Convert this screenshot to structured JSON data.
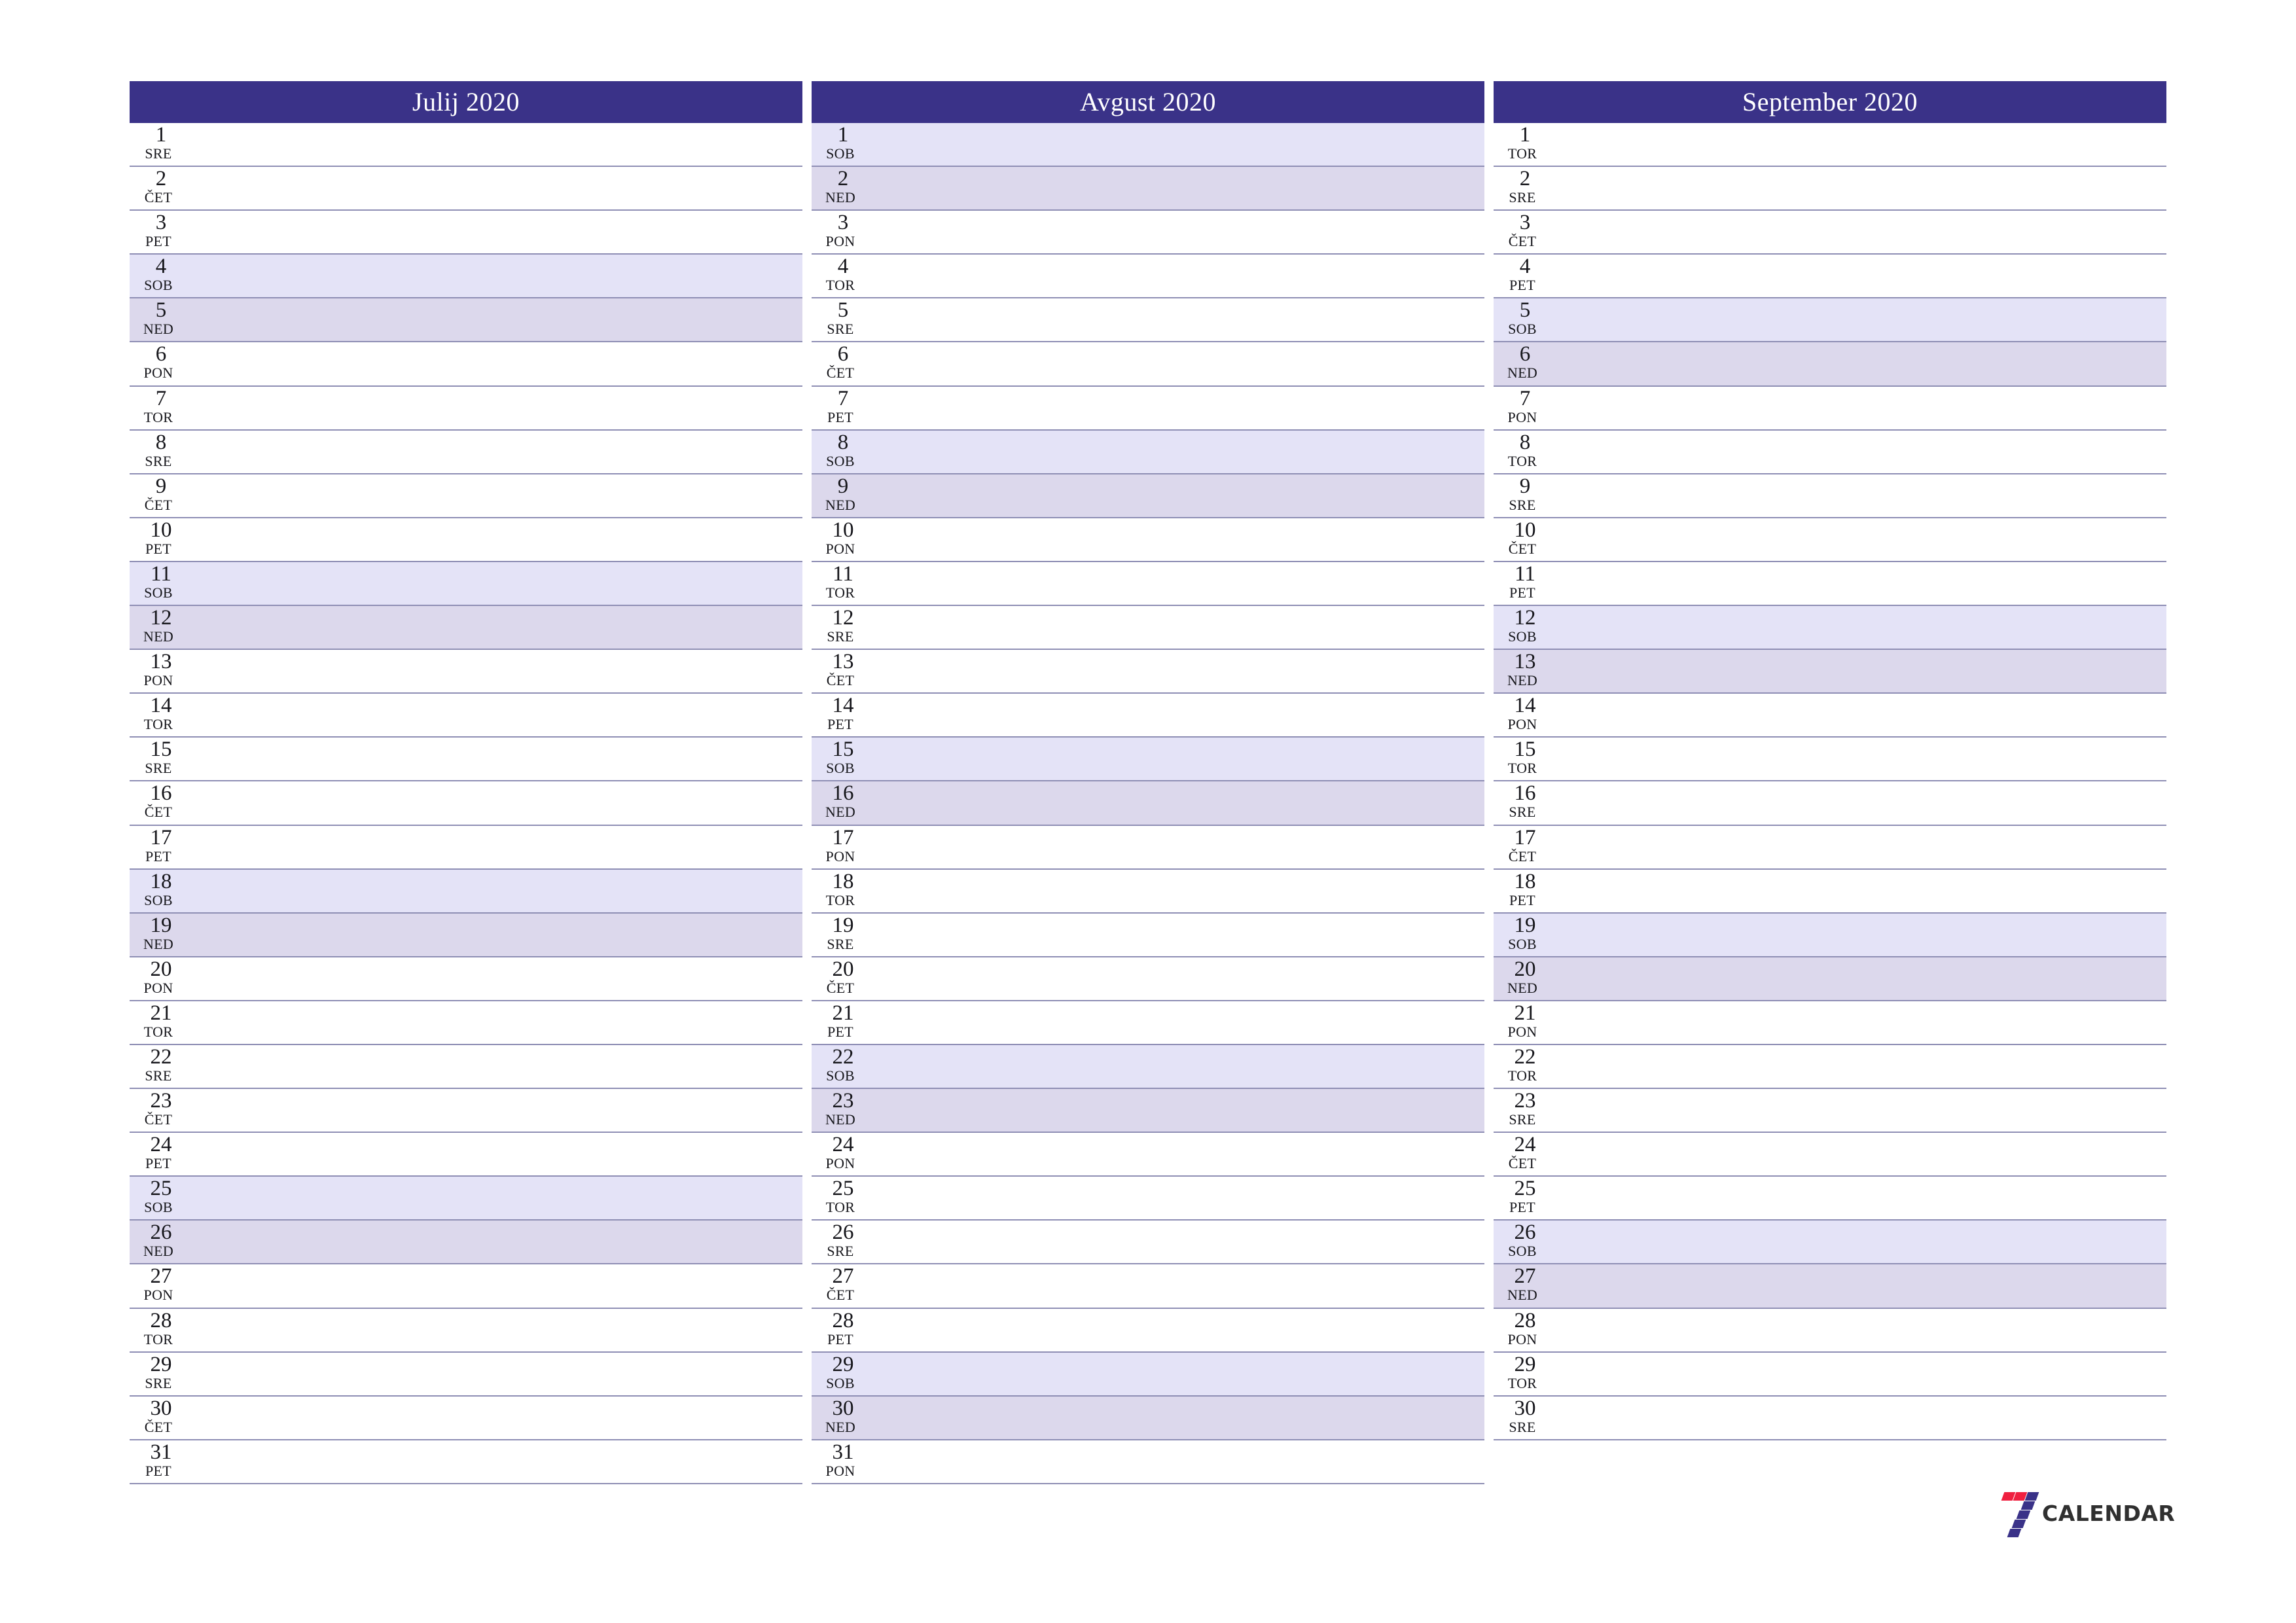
{
  "document": {
    "type": "quarterly-planner-calendar",
    "language": "sl",
    "year": "2020"
  },
  "colors": {
    "header_background": "#3a3288",
    "header_text": "#ffffff",
    "saturday_background": "#e4e3f7",
    "sunday_background": "#dcd8ec",
    "row_separator": "#8e8eb4",
    "day_text": "#17171c",
    "logo_red": "#ef2040",
    "logo_navy": "#3a3288",
    "logo_word": "#303030",
    "page_background": "#ffffff"
  },
  "brand": {
    "logo_name": "seven-calendar-logo",
    "wordmark": "CALENDAR",
    "mark_digit": "7"
  },
  "months": [
    {
      "title": "Julij 2020",
      "name": "Julij",
      "year": "2020",
      "days": [
        {
          "num": "1",
          "wd": "SRE",
          "type": "weekday"
        },
        {
          "num": "2",
          "wd": "ČET",
          "type": "weekday"
        },
        {
          "num": "3",
          "wd": "PET",
          "type": "weekday"
        },
        {
          "num": "4",
          "wd": "SOB",
          "type": "saturday"
        },
        {
          "num": "5",
          "wd": "NED",
          "type": "sunday"
        },
        {
          "num": "6",
          "wd": "PON",
          "type": "weekday"
        },
        {
          "num": "7",
          "wd": "TOR",
          "type": "weekday"
        },
        {
          "num": "8",
          "wd": "SRE",
          "type": "weekday"
        },
        {
          "num": "9",
          "wd": "ČET",
          "type": "weekday"
        },
        {
          "num": "10",
          "wd": "PET",
          "type": "weekday"
        },
        {
          "num": "11",
          "wd": "SOB",
          "type": "saturday"
        },
        {
          "num": "12",
          "wd": "NED",
          "type": "sunday"
        },
        {
          "num": "13",
          "wd": "PON",
          "type": "weekday"
        },
        {
          "num": "14",
          "wd": "TOR",
          "type": "weekday"
        },
        {
          "num": "15",
          "wd": "SRE",
          "type": "weekday"
        },
        {
          "num": "16",
          "wd": "ČET",
          "type": "weekday"
        },
        {
          "num": "17",
          "wd": "PET",
          "type": "weekday"
        },
        {
          "num": "18",
          "wd": "SOB",
          "type": "saturday"
        },
        {
          "num": "19",
          "wd": "NED",
          "type": "sunday"
        },
        {
          "num": "20",
          "wd": "PON",
          "type": "weekday"
        },
        {
          "num": "21",
          "wd": "TOR",
          "type": "weekday"
        },
        {
          "num": "22",
          "wd": "SRE",
          "type": "weekday"
        },
        {
          "num": "23",
          "wd": "ČET",
          "type": "weekday"
        },
        {
          "num": "24",
          "wd": "PET",
          "type": "weekday"
        },
        {
          "num": "25",
          "wd": "SOB",
          "type": "saturday"
        },
        {
          "num": "26",
          "wd": "NED",
          "type": "sunday"
        },
        {
          "num": "27",
          "wd": "PON",
          "type": "weekday"
        },
        {
          "num": "28",
          "wd": "TOR",
          "type": "weekday"
        },
        {
          "num": "29",
          "wd": "SRE",
          "type": "weekday"
        },
        {
          "num": "30",
          "wd": "ČET",
          "type": "weekday"
        },
        {
          "num": "31",
          "wd": "PET",
          "type": "weekday"
        }
      ]
    },
    {
      "title": "Avgust 2020",
      "name": "Avgust",
      "year": "2020",
      "days": [
        {
          "num": "1",
          "wd": "SOB",
          "type": "saturday"
        },
        {
          "num": "2",
          "wd": "NED",
          "type": "sunday"
        },
        {
          "num": "3",
          "wd": "PON",
          "type": "weekday"
        },
        {
          "num": "4",
          "wd": "TOR",
          "type": "weekday"
        },
        {
          "num": "5",
          "wd": "SRE",
          "type": "weekday"
        },
        {
          "num": "6",
          "wd": "ČET",
          "type": "weekday"
        },
        {
          "num": "7",
          "wd": "PET",
          "type": "weekday"
        },
        {
          "num": "8",
          "wd": "SOB",
          "type": "saturday"
        },
        {
          "num": "9",
          "wd": "NED",
          "type": "sunday"
        },
        {
          "num": "10",
          "wd": "PON",
          "type": "weekday"
        },
        {
          "num": "11",
          "wd": "TOR",
          "type": "weekday"
        },
        {
          "num": "12",
          "wd": "SRE",
          "type": "weekday"
        },
        {
          "num": "13",
          "wd": "ČET",
          "type": "weekday"
        },
        {
          "num": "14",
          "wd": "PET",
          "type": "weekday"
        },
        {
          "num": "15",
          "wd": "SOB",
          "type": "saturday"
        },
        {
          "num": "16",
          "wd": "NED",
          "type": "sunday"
        },
        {
          "num": "17",
          "wd": "PON",
          "type": "weekday"
        },
        {
          "num": "18",
          "wd": "TOR",
          "type": "weekday"
        },
        {
          "num": "19",
          "wd": "SRE",
          "type": "weekday"
        },
        {
          "num": "20",
          "wd": "ČET",
          "type": "weekday"
        },
        {
          "num": "21",
          "wd": "PET",
          "type": "weekday"
        },
        {
          "num": "22",
          "wd": "SOB",
          "type": "saturday"
        },
        {
          "num": "23",
          "wd": "NED",
          "type": "sunday"
        },
        {
          "num": "24",
          "wd": "PON",
          "type": "weekday"
        },
        {
          "num": "25",
          "wd": "TOR",
          "type": "weekday"
        },
        {
          "num": "26",
          "wd": "SRE",
          "type": "weekday"
        },
        {
          "num": "27",
          "wd": "ČET",
          "type": "weekday"
        },
        {
          "num": "28",
          "wd": "PET",
          "type": "weekday"
        },
        {
          "num": "29",
          "wd": "SOB",
          "type": "saturday"
        },
        {
          "num": "30",
          "wd": "NED",
          "type": "sunday"
        },
        {
          "num": "31",
          "wd": "PON",
          "type": "weekday"
        }
      ]
    },
    {
      "title": "September 2020",
      "name": "September",
      "year": "2020",
      "days": [
        {
          "num": "1",
          "wd": "TOR",
          "type": "weekday"
        },
        {
          "num": "2",
          "wd": "SRE",
          "type": "weekday"
        },
        {
          "num": "3",
          "wd": "ČET",
          "type": "weekday"
        },
        {
          "num": "4",
          "wd": "PET",
          "type": "weekday"
        },
        {
          "num": "5",
          "wd": "SOB",
          "type": "saturday"
        },
        {
          "num": "6",
          "wd": "NED",
          "type": "sunday"
        },
        {
          "num": "7",
          "wd": "PON",
          "type": "weekday"
        },
        {
          "num": "8",
          "wd": "TOR",
          "type": "weekday"
        },
        {
          "num": "9",
          "wd": "SRE",
          "type": "weekday"
        },
        {
          "num": "10",
          "wd": "ČET",
          "type": "weekday"
        },
        {
          "num": "11",
          "wd": "PET",
          "type": "weekday"
        },
        {
          "num": "12",
          "wd": "SOB",
          "type": "saturday"
        },
        {
          "num": "13",
          "wd": "NED",
          "type": "sunday"
        },
        {
          "num": "14",
          "wd": "PON",
          "type": "weekday"
        },
        {
          "num": "15",
          "wd": "TOR",
          "type": "weekday"
        },
        {
          "num": "16",
          "wd": "SRE",
          "type": "weekday"
        },
        {
          "num": "17",
          "wd": "ČET",
          "type": "weekday"
        },
        {
          "num": "18",
          "wd": "PET",
          "type": "weekday"
        },
        {
          "num": "19",
          "wd": "SOB",
          "type": "saturday"
        },
        {
          "num": "20",
          "wd": "NED",
          "type": "sunday"
        },
        {
          "num": "21",
          "wd": "PON",
          "type": "weekday"
        },
        {
          "num": "22",
          "wd": "TOR",
          "type": "weekday"
        },
        {
          "num": "23",
          "wd": "SRE",
          "type": "weekday"
        },
        {
          "num": "24",
          "wd": "ČET",
          "type": "weekday"
        },
        {
          "num": "25",
          "wd": "PET",
          "type": "weekday"
        },
        {
          "num": "26",
          "wd": "SOB",
          "type": "saturday"
        },
        {
          "num": "27",
          "wd": "NED",
          "type": "sunday"
        },
        {
          "num": "28",
          "wd": "PON",
          "type": "weekday"
        },
        {
          "num": "29",
          "wd": "TOR",
          "type": "weekday"
        },
        {
          "num": "30",
          "wd": "SRE",
          "type": "weekday"
        }
      ]
    }
  ]
}
